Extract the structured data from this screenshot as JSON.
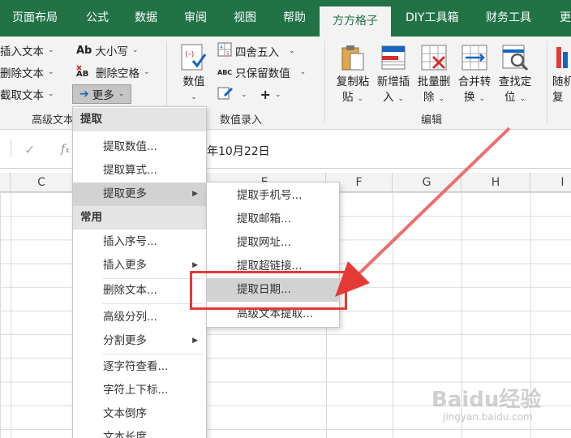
{
  "tabs": [
    "页面布局",
    "公式",
    "数据",
    "审阅",
    "视图",
    "帮助",
    "方方格子",
    "DIY工具箱",
    "财务工具",
    "更"
  ],
  "ribbon": {
    "text_group": {
      "insert_text": "插入文本",
      "delete_text": "删除文本",
      "extract_text": "截取文本",
      "case_label": "大小写",
      "case_icon": "Ab",
      "delete_space": "删除空格",
      "more": "更多",
      "label": "高级文本"
    },
    "number_group": {
      "value_btn": "数值",
      "round": "四舍五入",
      "keep_values": "只保留数值",
      "label": "数值录入"
    },
    "edit_group": {
      "copy_paste_1": "复制粘",
      "copy_paste_2": "贴",
      "add_insert_1": "新增插",
      "add_insert_2": "入",
      "batch_delete_1": "批量删",
      "batch_delete_2": "除",
      "merge_convert_1": "合并转",
      "merge_convert_2": "换",
      "find_locate_1": "查找定",
      "find_locate_2": "位",
      "random_1": "随机",
      "random_2": "复",
      "label": "编辑"
    }
  },
  "formula_bar": {
    "content": "年10月22日"
  },
  "columns": [
    "C",
    "D",
    "E",
    "F",
    "G",
    "H",
    "I"
  ],
  "main_menu": {
    "header_extract": "提取",
    "extract_value": "提取数值...",
    "extract_formula": "提取算式...",
    "extract_more": "提取更多",
    "header_common": "常用",
    "insert_seq": "插入序号...",
    "insert_more": "插入更多",
    "delete_text": "删除文本...",
    "adv_split": "高级分列...",
    "split_more": "分割更多",
    "char_view": "逐字符查看...",
    "superscript": "字符上下标...",
    "reverse_text": "文本倒序",
    "text_length": "文本长度"
  },
  "sub_menu": {
    "phone": "提取手机号...",
    "email": "提取邮箱...",
    "url": "提取网址...",
    "hyperlink": "提取超链接...",
    "date": "提取日期...",
    "adv_extract": "高级文本提取..."
  },
  "watermark": {
    "logo": "Baidu经验",
    "url": "jingyan.baidu.com"
  },
  "colors": {
    "excel_green": "#217346",
    "highlight_red": "#e53935"
  }
}
